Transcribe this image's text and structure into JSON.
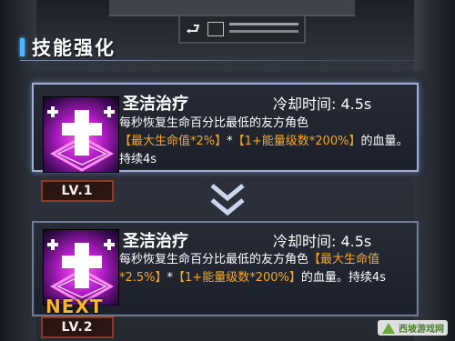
{
  "header": {
    "title": "技能强化"
  },
  "current_skill": {
    "name": "圣洁治疗",
    "cooldown": "冷却时间: 4.5s",
    "desc_prefix": "每秒恢复生命百分比最低的友方角色",
    "desc_hl1": "【最大生命值*2%】",
    "desc_mid": "*",
    "desc_hl2": "【1+能量级数*200%】",
    "desc_suffix": "的血量。持续4s",
    "level": "LV.1"
  },
  "next_skill": {
    "name": "圣洁治疗",
    "cooldown": "冷却时间: 4.5s",
    "desc_prefix": "每秒恢复生命百分比最低的友方角色",
    "desc_hl1": "【最大生命值*2.5%】",
    "desc_mid": "*",
    "desc_hl2": "【1+能量级数*200%】",
    "desc_suffix": "的血量。持续4s",
    "next_label": "NEXT",
    "level": "LV.2"
  },
  "watermark": {
    "text": "西坡游戏网"
  },
  "colors": {
    "highlight": "#f6a928",
    "accent": "#4fb6ff",
    "icon_magenta": "#ff5ef0",
    "level_border": "#8d3a22"
  },
  "icons": {
    "skill": "holy-cross-icon",
    "upgrade_arrow": "double-chevron-down-icon",
    "sign_arrow": "left-arrow-icon"
  }
}
